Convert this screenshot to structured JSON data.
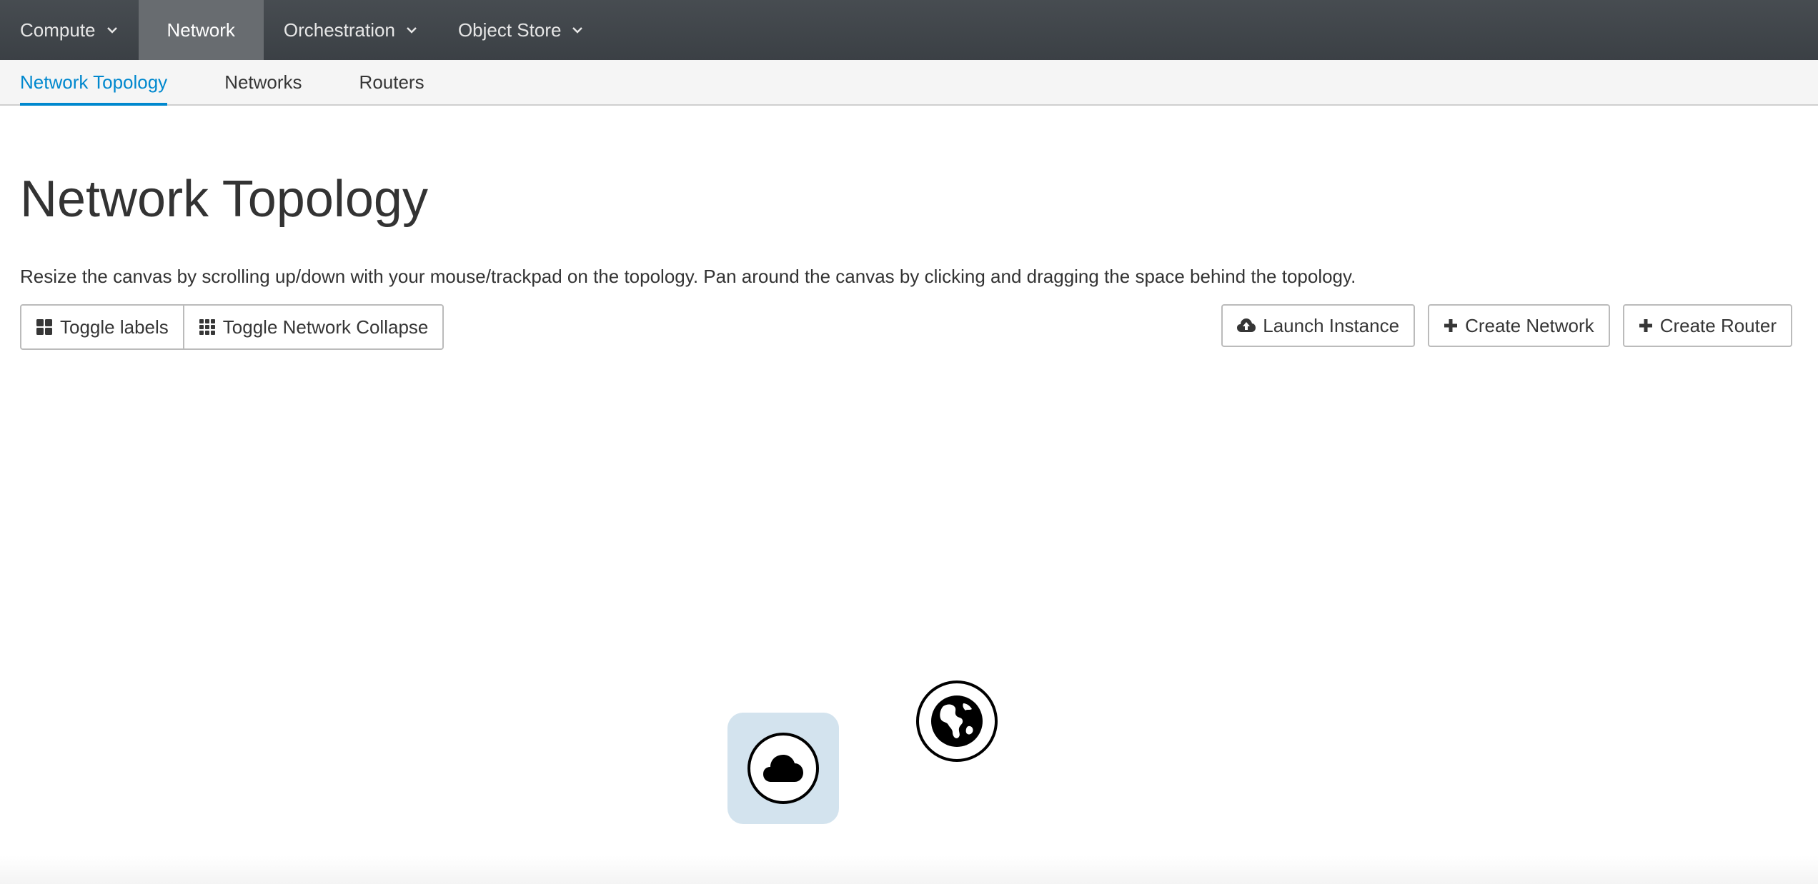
{
  "topnav": {
    "items": [
      {
        "label": "Compute",
        "dropdown": true,
        "active": false
      },
      {
        "label": "Network",
        "dropdown": false,
        "active": true
      },
      {
        "label": "Orchestration",
        "dropdown": true,
        "active": false
      },
      {
        "label": "Object Store",
        "dropdown": true,
        "active": false
      }
    ]
  },
  "subnav": {
    "items": [
      {
        "label": "Network Topology",
        "active": true
      },
      {
        "label": "Networks",
        "active": false
      },
      {
        "label": "Routers",
        "active": false
      }
    ]
  },
  "page": {
    "title": "Network Topology",
    "help_text": "Resize the canvas by scrolling up/down with your mouse/trackpad on the topology. Pan around the canvas by clicking and dragging the space behind the topology."
  },
  "toolbar": {
    "toggle_labels": "Toggle labels",
    "toggle_network_collapse": "Toggle Network Collapse",
    "launch_instance": "Launch Instance",
    "create_network": "Create Network",
    "create_router": "Create Router"
  },
  "topology": {
    "nodes": [
      {
        "type": "network",
        "icon": "cloud-icon"
      },
      {
        "type": "external-network",
        "icon": "globe-icon"
      }
    ]
  },
  "colors": {
    "topnav_bg": "#3f4449",
    "topnav_active_bg": "#686c70",
    "accent": "#0088ce",
    "node_highlight": "#d3e3ee"
  }
}
